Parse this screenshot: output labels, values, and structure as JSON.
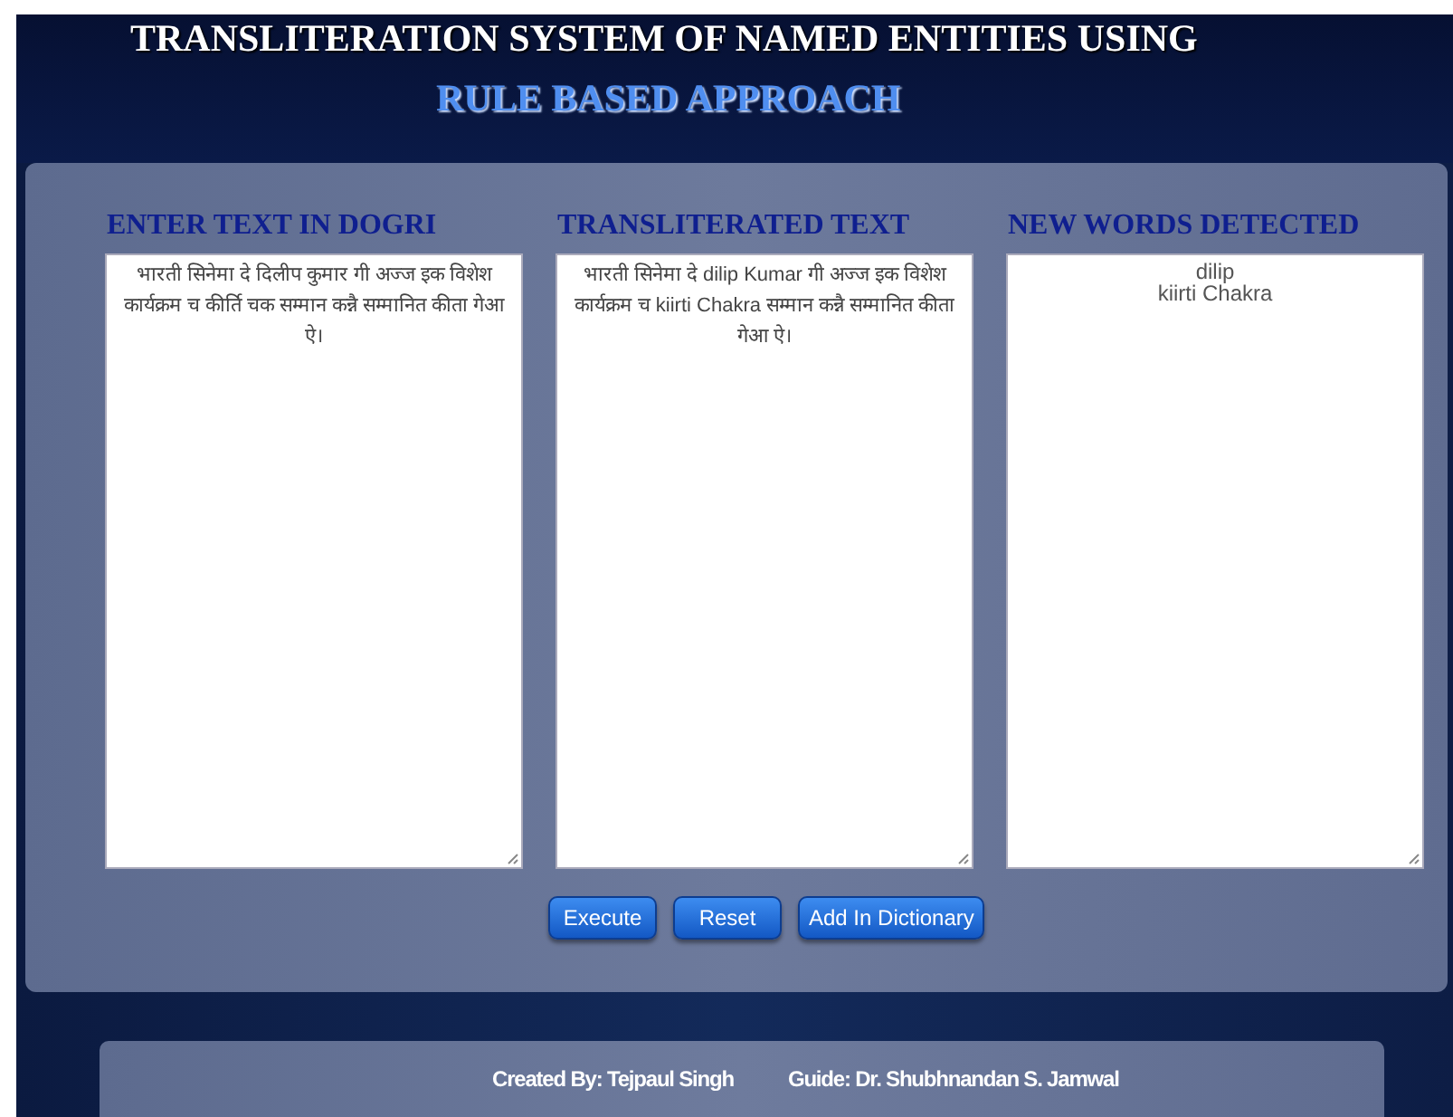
{
  "header": {
    "title": "TRANSLITERATION SYSTEM OF NAMED ENTITIES USING",
    "subtitle": "RULE BASED APPROACH"
  },
  "columns": [
    {
      "heading": "ENTER TEXT IN DOGRI",
      "text": "भारती सिनेमा दे दिलीप कुमार गी अज्ज इक विशेश कार्यक्रम च कीर्ति चक सम्मान कन्नै सम्मानित कीता गेआ ऐ।"
    },
    {
      "heading": "TRANSLITERATED TEXT",
      "text": "भारती सिनेमा दे dilip Kumar गी अज्ज इक विशेश कार्यक्रम च kiirti Chakra सम्मान कन्नै सम्मानित कीता गेआ ऐ।"
    },
    {
      "heading": "NEW WORDS DETECTED",
      "lines": [
        "dilip",
        "kiirti Chakra"
      ]
    }
  ],
  "buttons": [
    "Execute",
    "Reset",
    "Add In Dictionary"
  ],
  "footer": {
    "created_by": "Created By: Tejpaul Singh",
    "guide": "Guide: Dr. Shubhnandan S. Jamwal"
  }
}
